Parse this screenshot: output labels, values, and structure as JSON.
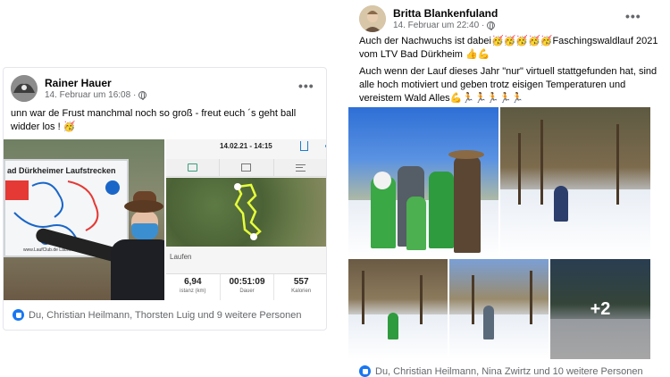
{
  "post1": {
    "author": "Rainer Hauer",
    "timestamp": "14. Februar um 16:08 ·",
    "text_line1": "unn war de Frust manchmal noch so groß - freut euch ´s geht ball",
    "text_line2": "widder los ! 🥳",
    "more_menu": "•••",
    "photo": {
      "board_title": "ad Dürkheimer Laufstrecken",
      "board_footer": "www.LaufClub.de   LaufClub"
    },
    "app": {
      "date": "14.02.21 - 14:15",
      "activity": "Laufen",
      "stats": [
        {
          "value": "6,94",
          "label": "istanz (km)"
        },
        {
          "value": "00:51:09",
          "label": "Dauer"
        },
        {
          "value": "557",
          "label": "Kalorien"
        }
      ]
    },
    "reactions": "Du, Christian Heilmann, Thorsten Luig und 9 weitere Personen"
  },
  "post2": {
    "author": "Britta Blankenfuland",
    "timestamp": "14. Februar um 22:40 ·",
    "more_menu": "•••",
    "text_line1": "Auch der Nachwuchs ist dabei🥳🥳🥳🥳🥳Faschingswaldlauf 2021",
    "text_line2": "vom LTV Bad Dürkheim 👍💪",
    "text_line3": "Auch wenn der Lauf dieses Jahr \"nur\" virtuell stattgefunden hat, sind",
    "text_line4": "alle hoch motiviert und geben trotz eisigen Temperaturen und",
    "text_line5": "vereistem Wald Alles💪🏃🏃🏃🏃🏃",
    "more_photos": "+2",
    "reactions": "Du, Christian Heilmann, Nina Zwirtz und 10 weitere Personen"
  },
  "colors": {
    "like_blue": "#1877f2",
    "meta_gray": "#65676b"
  },
  "icons": [
    "globe-icon",
    "like-icon",
    "more-options-icon",
    "share-icon",
    "map-tab-icon",
    "photo-tab-icon",
    "list-tab-icon"
  ]
}
